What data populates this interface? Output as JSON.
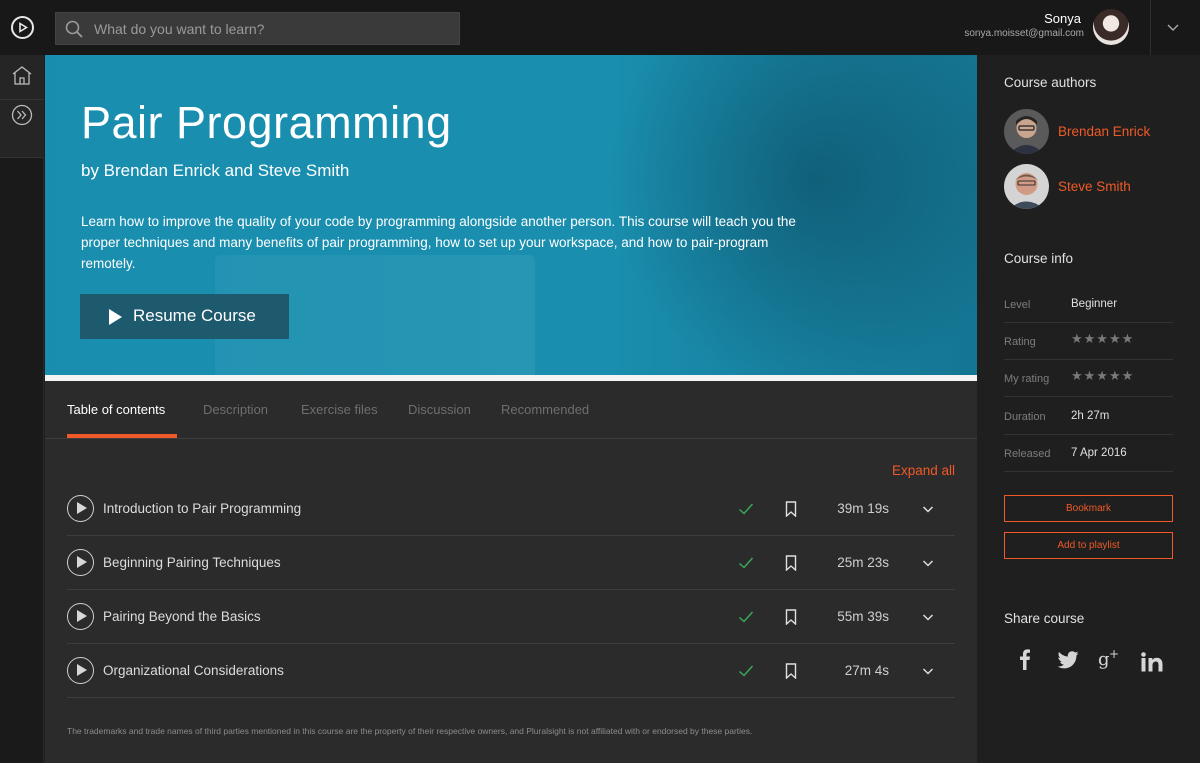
{
  "search": {
    "placeholder": "What do you want to learn?"
  },
  "user": {
    "name": "Sonya",
    "email": "sonya.moisset@gmail.com"
  },
  "course": {
    "title": "Pair Programming",
    "byline": "by Brendan Enrick and Steve Smith",
    "description": "Learn how to improve the quality of your code by programming alongside another person. This course will teach you the proper techniques and many benefits of pair programming, how to set up your workspace, and how to pair-program remotely.",
    "resume_label": "Resume Course"
  },
  "tabs": [
    {
      "label": "Table of contents",
      "active": true
    },
    {
      "label": "Description",
      "active": false
    },
    {
      "label": "Exercise files",
      "active": false
    },
    {
      "label": "Discussion",
      "active": false
    },
    {
      "label": "Recommended",
      "active": false
    }
  ],
  "toc": {
    "expand_all": "Expand all",
    "modules": [
      {
        "title": "Introduction to Pair Programming",
        "duration": "39m 19s",
        "completed": true
      },
      {
        "title": "Beginning Pairing Techniques",
        "duration": "25m 23s",
        "completed": true
      },
      {
        "title": "Pairing Beyond the Basics",
        "duration": "55m 39s",
        "completed": true
      },
      {
        "title": "Organizational Considerations",
        "duration": "27m 4s",
        "completed": true
      }
    ],
    "disclaimer": "The trademarks and trade names of third parties mentioned in this course are the property of their respective owners, and Pluralsight is not affiliated with or endorsed by these parties."
  },
  "sidebar": {
    "authors_heading": "Course authors",
    "authors": [
      {
        "name": "Brendan Enrick"
      },
      {
        "name": "Steve Smith"
      }
    ],
    "info_heading": "Course info",
    "info": {
      "level_label": "Level",
      "level_value": "Beginner",
      "rating_label": "Rating",
      "rating_stars": "★★★★★",
      "my_rating_label": "My rating",
      "my_rating_stars": "★★★★★",
      "duration_label": "Duration",
      "duration_value": "2h 27m",
      "released_label": "Released",
      "released_value": "7 Apr 2016"
    },
    "bookmark_label": "Bookmark",
    "playlist_label": "Add to playlist",
    "share_heading": "Share course",
    "share": [
      {
        "icon": "facebook-icon",
        "glyph": "f"
      },
      {
        "icon": "twitter-icon",
        "glyph": "t"
      },
      {
        "icon": "google-plus-icon",
        "glyph": "g+"
      },
      {
        "icon": "linkedin-icon",
        "glyph": "in"
      }
    ]
  },
  "colors": {
    "accent": "#f05a28",
    "hero": "#1a8fae",
    "check": "#3aa85a"
  }
}
